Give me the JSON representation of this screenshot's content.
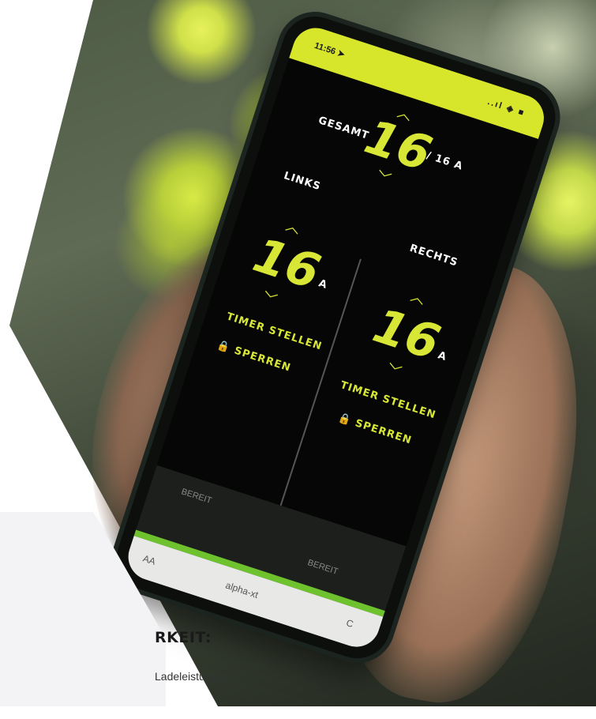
{
  "page": {
    "headline": "RKEIT:",
    "subline": "Ladeleistung"
  },
  "phone": {
    "status": {
      "time": "11:56",
      "signal": "..ıl ◈ ■"
    },
    "total": {
      "label": "GESAMT",
      "value": "16",
      "max": "/ 16 A"
    },
    "left": {
      "label": "LINKS",
      "value": "16",
      "unit": "A",
      "timer": "TIMER STELLEN",
      "lock": "SPERREN",
      "state": "BEREIT"
    },
    "right": {
      "label": "RECHTS",
      "value": "16",
      "unit": "A",
      "timer": "TIMER STELLEN",
      "lock": "SPERREN",
      "state": "BEREIT"
    },
    "browser": {
      "text_size": "AA",
      "url": "alpha-xt",
      "reload": "C"
    }
  },
  "colors": {
    "accent": "#d8e636",
    "progress": "#6ec22e",
    "panel": "#f3f3f5"
  },
  "icons": [
    "chevron-up-icon",
    "chevron-down-icon",
    "lock-icon",
    "location-arrow-icon",
    "reload-icon"
  ]
}
